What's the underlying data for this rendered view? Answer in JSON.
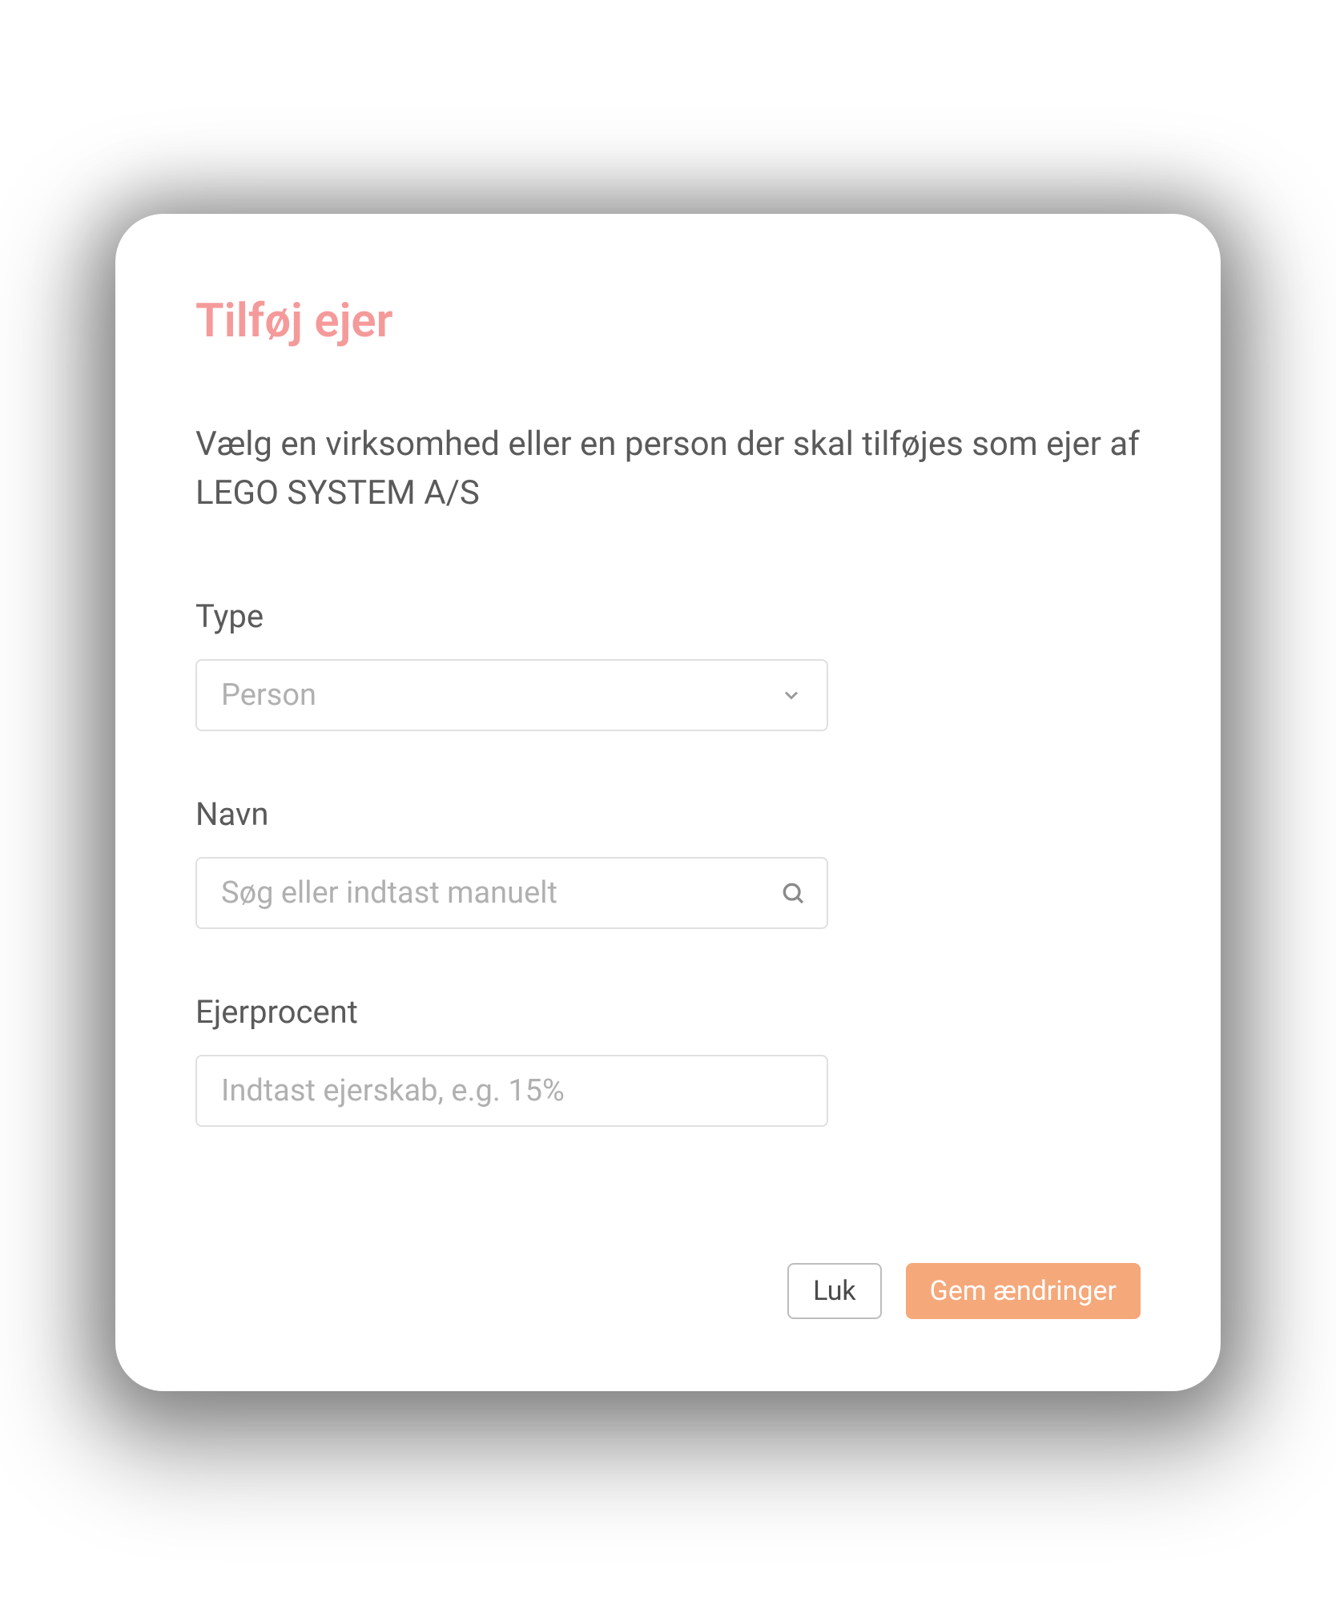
{
  "modal": {
    "title": "Tilføj ejer",
    "description": "Vælg en virksomhed eller en person der skal tilføjes som ejer af LEGO SYSTEM A/S",
    "fields": {
      "type": {
        "label": "Type",
        "selected": "Person"
      },
      "name": {
        "label": "Navn",
        "placeholder": "Søg eller indtast manuelt"
      },
      "ownership": {
        "label": "Ejerprocent",
        "placeholder": "Indtast ejerskab, e.g. 15%"
      }
    },
    "buttons": {
      "close": "Luk",
      "save": "Gem ændringer"
    }
  },
  "colors": {
    "accent_pink": "#f59a9a",
    "accent_orange": "#f5a87a"
  }
}
